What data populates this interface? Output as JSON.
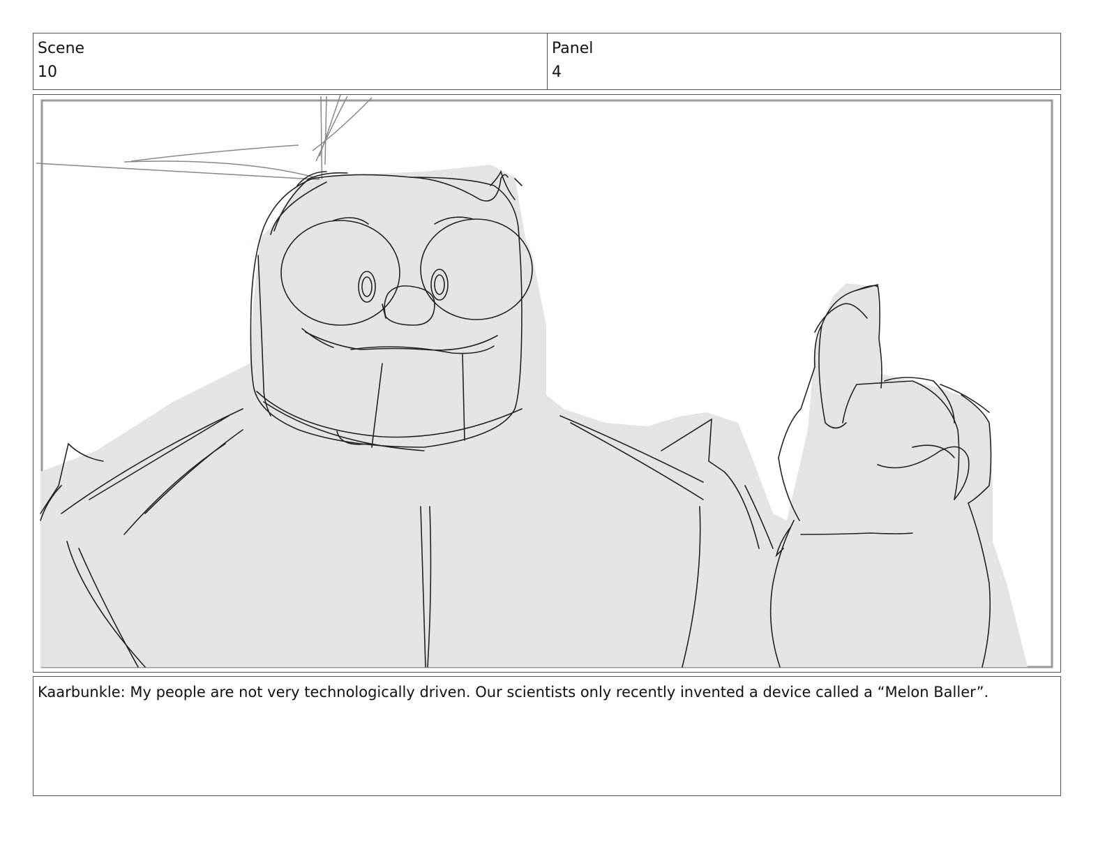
{
  "header": {
    "scene_label": "Scene",
    "scene_value": "10",
    "panel_label": "Panel",
    "panel_value": "4"
  },
  "drawing": {
    "subject": "rough sketch of a round-faced character pointing upward"
  },
  "caption": {
    "text": "Kaarbunkle: My people are not very technologically driven. Our scientists only recently invented a device called a “Melon Baller”."
  }
}
